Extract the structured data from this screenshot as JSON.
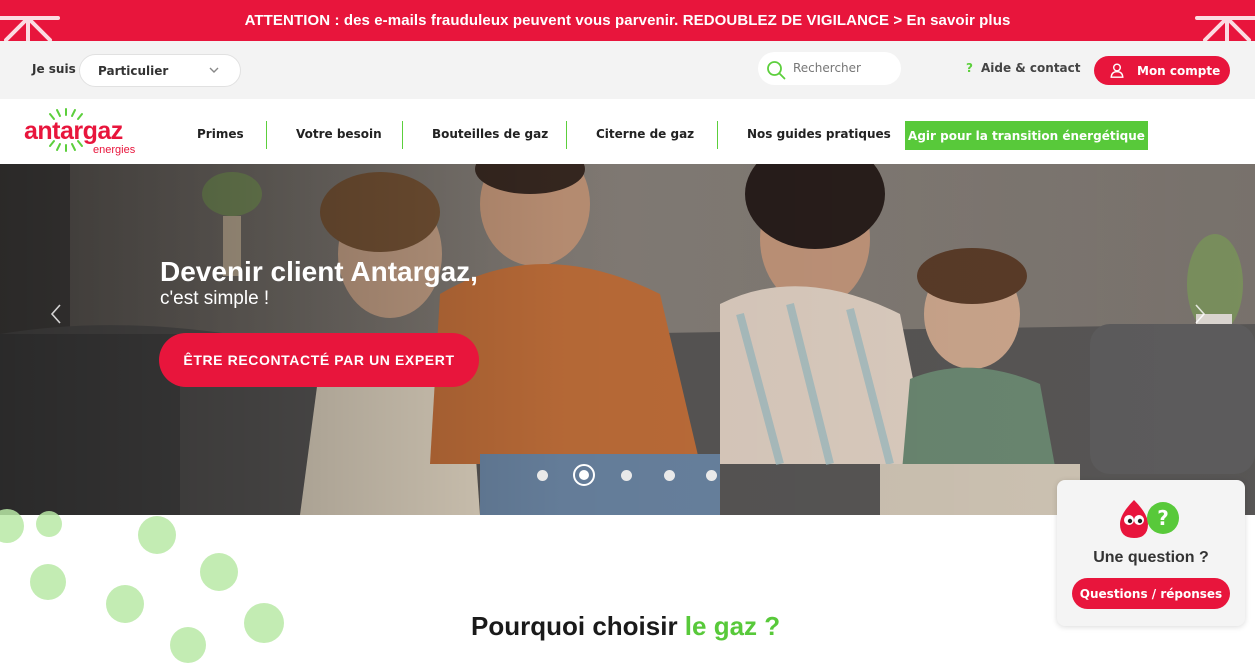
{
  "alert": {
    "text": "ATTENTION : des e-mails frauduleux peuvent vous parvenir. REDOUBLEZ DE VIGILANCE > En savoir plus"
  },
  "util": {
    "je_suis_label": "Je suis :",
    "profile_value": "Particulier",
    "search_placeholder": "Rechercher",
    "help_label": "Aide & contact",
    "account_label": "Mon compte"
  },
  "logo": {
    "word": "antargaz",
    "sub": "energies"
  },
  "nav": {
    "items": [
      "Primes",
      "Votre besoin",
      "Bouteilles de gaz",
      "Citerne de gaz",
      "Nos guides pratiques"
    ],
    "cta": "Agir pour la transition énergétique"
  },
  "hero": {
    "title": "Devenir client Antargaz,",
    "subtitle": "c'est simple !",
    "button": "ÊTRE RECONTACTÉ PAR UN EXPERT",
    "slide_count": 5,
    "active_slide": 2
  },
  "section": {
    "title_main": "Pourquoi choisir ",
    "title_accent": "le gaz ?"
  },
  "faq": {
    "title": "Une question ?",
    "button": "Questions / réponses"
  },
  "colors": {
    "brand_red": "#e8153c",
    "brand_green": "#58c93a",
    "light_gray": "#f3f3f3"
  },
  "icons": [
    "search-icon",
    "chevron-down-icon",
    "help-icon",
    "user-icon",
    "chevron-left-icon",
    "chevron-right-icon",
    "mascot-icon"
  ]
}
